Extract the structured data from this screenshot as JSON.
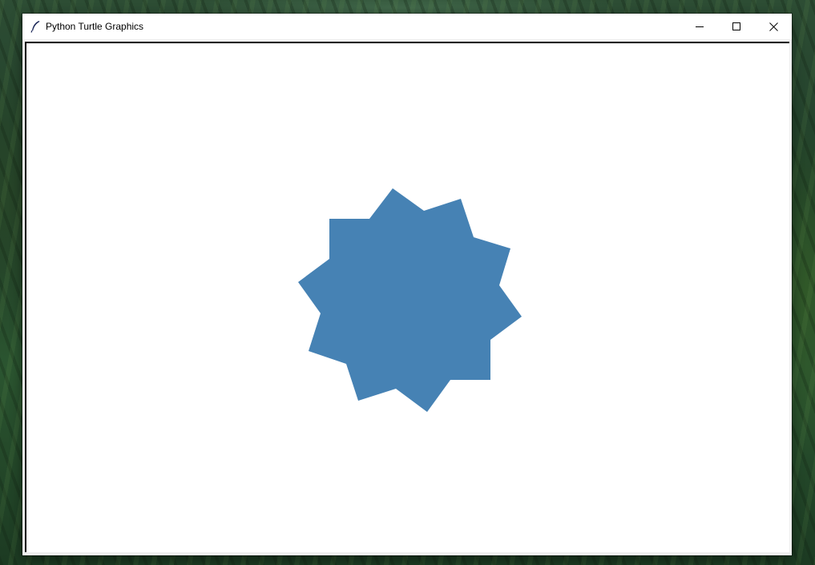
{
  "window": {
    "title": "Python Turtle Graphics",
    "controls": [
      "minimize-icon",
      "maximize-icon",
      "close-icon"
    ]
  },
  "canvas": {
    "background": "#ffffff",
    "shape": {
      "kind": "ten-pointed star (filled polygon)",
      "fill": "#4682b4"
    }
  },
  "icons": {
    "app_icon": "feather-icon"
  }
}
